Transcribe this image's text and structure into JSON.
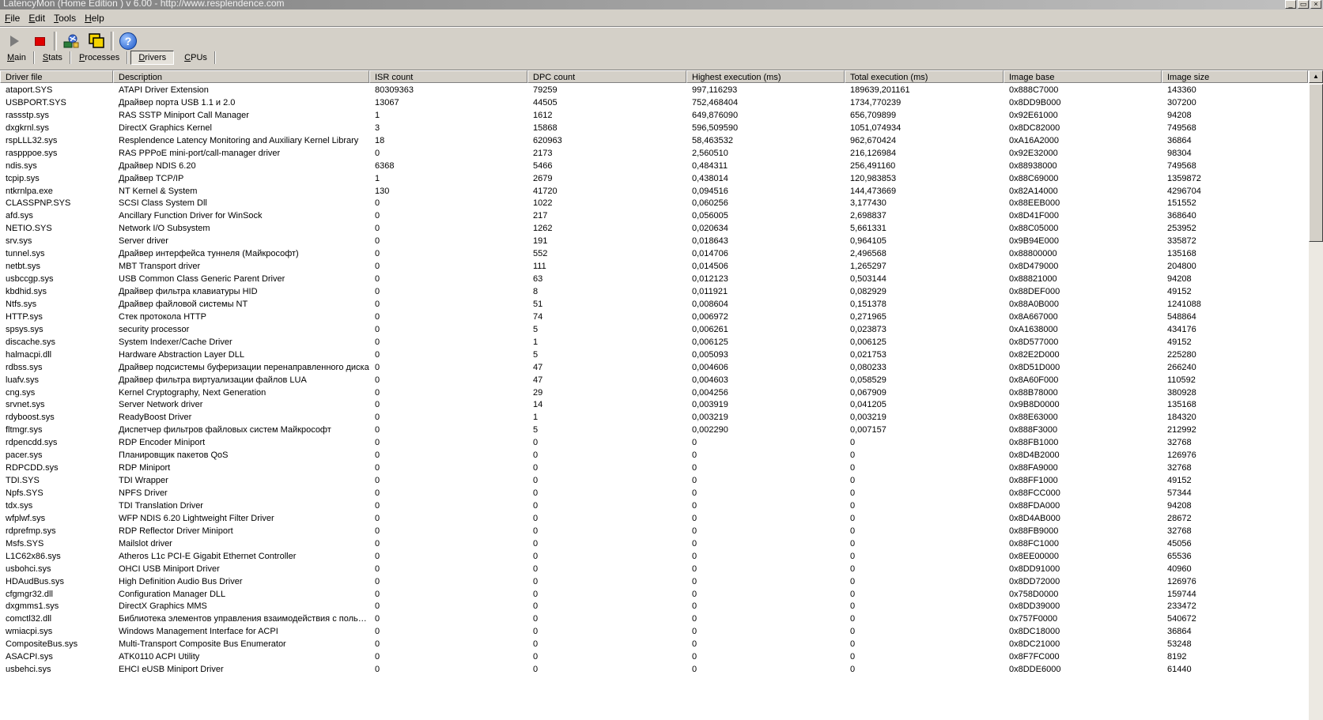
{
  "window": {
    "title": "LatencyMon  (Home Edition )  v 6.00 - http://www.resplendence.com"
  },
  "menu": [
    "File",
    "Edit",
    "Tools",
    "Help"
  ],
  "toolbar": {
    "start": "play-icon",
    "stop": "stop-icon",
    "tool1": "drivers-tool-icon",
    "tool2": "windows-tool-icon",
    "help_glyph": "?"
  },
  "tabs": [
    "Main",
    "Stats",
    "Processes",
    "Drivers",
    "CPUs"
  ],
  "active_tab": "Drivers",
  "columns": [
    "Driver file",
    "Description",
    "ISR count",
    "DPC count",
    "Highest execution (ms)",
    "Total execution (ms)",
    "Image base",
    "Image size"
  ],
  "rows": [
    [
      "ataport.SYS",
      "ATAPI Driver Extension",
      "80309363",
      "79259",
      "997,116293",
      "189639,201161",
      "0x888C7000",
      "143360"
    ],
    [
      "USBPORT.SYS",
      "Драйвер порта USB 1.1 и 2.0",
      "13067",
      "44505",
      "752,468404",
      "1734,770239",
      "0x8DD9B000",
      "307200"
    ],
    [
      "rassstp.sys",
      "RAS SSTP Miniport Call Manager",
      "1",
      "1612",
      "649,876090",
      "656,709899",
      "0x92E61000",
      "94208"
    ],
    [
      "dxgkrnl.sys",
      "DirectX Graphics Kernel",
      "3",
      "15868",
      "596,509590",
      "1051,074934",
      "0x8DC82000",
      "749568"
    ],
    [
      "rspLLL32.sys",
      "Resplendence Latency Monitoring and Auxiliary Kernel Library",
      "18",
      "620963",
      "58,463532",
      "962,670424",
      "0xA16A2000",
      "36864"
    ],
    [
      "raspppoe.sys",
      "RAS PPPoE mini-port/call-manager driver",
      "0",
      "2173",
      "2,560510",
      "216,126984",
      "0x92E32000",
      "98304"
    ],
    [
      "ndis.sys",
      "Драйвер NDIS 6.20",
      "6368",
      "5466",
      "0,484311",
      "256,491160",
      "0x88938000",
      "749568"
    ],
    [
      "tcpip.sys",
      "Драйвер TCP/IP",
      "1",
      "2679",
      "0,438014",
      "120,983853",
      "0x88C69000",
      "1359872"
    ],
    [
      "ntkrnlpa.exe",
      "NT Kernel & System",
      "130",
      "41720",
      "0,094516",
      "144,473669",
      "0x82A14000",
      "4296704"
    ],
    [
      "CLASSPNP.SYS",
      "SCSI Class System Dll",
      "0",
      "1022",
      "0,060256",
      "3,177430",
      "0x88EEB000",
      "151552"
    ],
    [
      "afd.sys",
      "Ancillary Function Driver for WinSock",
      "0",
      "217",
      "0,056005",
      "2,698837",
      "0x8D41F000",
      "368640"
    ],
    [
      "NETIO.SYS",
      "Network I/O Subsystem",
      "0",
      "1262",
      "0,020634",
      "5,661331",
      "0x88C05000",
      "253952"
    ],
    [
      "srv.sys",
      "Server driver",
      "0",
      "191",
      "0,018643",
      "0,964105",
      "0x9B94E000",
      "335872"
    ],
    [
      "tunnel.sys",
      "Драйвер интерфейса туннеля (Майкрософт)",
      "0",
      "552",
      "0,014706",
      "2,496568",
      "0x88800000",
      "135168"
    ],
    [
      "netbt.sys",
      "MBT Transport driver",
      "0",
      "111",
      "0,014506",
      "1,265297",
      "0x8D479000",
      "204800"
    ],
    [
      "usbccgp.sys",
      "USB Common Class Generic Parent Driver",
      "0",
      "63",
      "0,012123",
      "0,503144",
      "0x88821000",
      "94208"
    ],
    [
      "kbdhid.sys",
      "Драйвер фильтра клавиатуры HID",
      "0",
      "8",
      "0,011921",
      "0,082929",
      "0x88DEF000",
      "49152"
    ],
    [
      "Ntfs.sys",
      "Драйвер файловой системы NT",
      "0",
      "51",
      "0,008604",
      "0,151378",
      "0x88A0B000",
      "1241088"
    ],
    [
      "HTTP.sys",
      "Стек протокола HTTP",
      "0",
      "74",
      "0,006972",
      "0,271965",
      "0x8A667000",
      "548864"
    ],
    [
      "spsys.sys",
      "security processor",
      "0",
      "5",
      "0,006261",
      "0,023873",
      "0xA1638000",
      "434176"
    ],
    [
      "discache.sys",
      "System Indexer/Cache Driver",
      "0",
      "1",
      "0,006125",
      "0,006125",
      "0x8D577000",
      "49152"
    ],
    [
      "halmacpi.dll",
      "Hardware Abstraction Layer DLL",
      "0",
      "5",
      "0,005093",
      "0,021753",
      "0x82E2D000",
      "225280"
    ],
    [
      "rdbss.sys",
      "Драйвер подсистемы буферизации перенаправленного диска",
      "0",
      "47",
      "0,004606",
      "0,080233",
      "0x8D51D000",
      "266240"
    ],
    [
      "luafv.sys",
      "Драйвер фильтра виртуализации файлов LUA",
      "0",
      "47",
      "0,004603",
      "0,058529",
      "0x8A60F000",
      "110592"
    ],
    [
      "cng.sys",
      "Kernel Cryptography, Next Generation",
      "0",
      "29",
      "0,004256",
      "0,067909",
      "0x88B78000",
      "380928"
    ],
    [
      "srvnet.sys",
      "Server Network driver",
      "0",
      "14",
      "0,003919",
      "0,041205",
      "0x9B8D0000",
      "135168"
    ],
    [
      "rdyboost.sys",
      "ReadyBoost Driver",
      "0",
      "1",
      "0,003219",
      "0,003219",
      "0x88E63000",
      "184320"
    ],
    [
      "fltmgr.sys",
      "Диспетчер фильтров файловых систем Майкрософт",
      "0",
      "5",
      "0,002290",
      "0,007157",
      "0x888F3000",
      "212992"
    ],
    [
      "rdpencdd.sys",
      "RDP Encoder Miniport",
      "0",
      "0",
      "0",
      "0",
      "0x88FB1000",
      "32768"
    ],
    [
      "pacer.sys",
      "Планировщик пакетов QoS",
      "0",
      "0",
      "0",
      "0",
      "0x8D4B2000",
      "126976"
    ],
    [
      "RDPCDD.sys",
      "RDP Miniport",
      "0",
      "0",
      "0",
      "0",
      "0x88FA9000",
      "32768"
    ],
    [
      "TDI.SYS",
      "TDI Wrapper",
      "0",
      "0",
      "0",
      "0",
      "0x88FF1000",
      "49152"
    ],
    [
      "Npfs.SYS",
      "NPFS Driver",
      "0",
      "0",
      "0",
      "0",
      "0x88FCC000",
      "57344"
    ],
    [
      "tdx.sys",
      "TDI Translation Driver",
      "0",
      "0",
      "0",
      "0",
      "0x88FDA000",
      "94208"
    ],
    [
      "wfplwf.sys",
      "WFP NDIS 6.20 Lightweight Filter Driver",
      "0",
      "0",
      "0",
      "0",
      "0x8D4AB000",
      "28672"
    ],
    [
      "rdprefmp.sys",
      "RDP Reflector Driver Miniport",
      "0",
      "0",
      "0",
      "0",
      "0x88FB9000",
      "32768"
    ],
    [
      "Msfs.SYS",
      "Mailslot driver",
      "0",
      "0",
      "0",
      "0",
      "0x88FC1000",
      "45056"
    ],
    [
      "L1C62x86.sys",
      "Atheros L1c PCI-E Gigabit Ethernet Controller",
      "0",
      "0",
      "0",
      "0",
      "0x8EE00000",
      "65536"
    ],
    [
      "usbohci.sys",
      "OHCI USB Miniport Driver",
      "0",
      "0",
      "0",
      "0",
      "0x8DD91000",
      "40960"
    ],
    [
      "HDAudBus.sys",
      "High Definition Audio Bus Driver",
      "0",
      "0",
      "0",
      "0",
      "0x8DD72000",
      "126976"
    ],
    [
      "cfgmgr32.dll",
      "Configuration Manager DLL",
      "0",
      "0",
      "0",
      "0",
      "0x758D0000",
      "159744"
    ],
    [
      "dxgmms1.sys",
      "DirectX Graphics MMS",
      "0",
      "0",
      "0",
      "0",
      "0x8DD39000",
      "233472"
    ],
    [
      "comctl32.dll",
      "Библиотека элементов управления взаимодействия с пользователем",
      "0",
      "0",
      "0",
      "0",
      "0x757F0000",
      "540672"
    ],
    [
      "wmiacpi.sys",
      "Windows Management Interface for ACPI",
      "0",
      "0",
      "0",
      "0",
      "0x8DC18000",
      "36864"
    ],
    [
      "CompositeBus.sys",
      "Multi-Transport Composite Bus Enumerator",
      "0",
      "0",
      "0",
      "0",
      "0x8DC21000",
      "53248"
    ],
    [
      "ASACPI.sys",
      "ATK0110 ACPI Utility",
      "0",
      "0",
      "0",
      "0",
      "0x8F7FC000",
      "8192"
    ],
    [
      "usbehci.sys",
      "EHCI eUSB Miniport Driver",
      "0",
      "0",
      "0",
      "0",
      "0x8DDE6000",
      "61440"
    ]
  ]
}
